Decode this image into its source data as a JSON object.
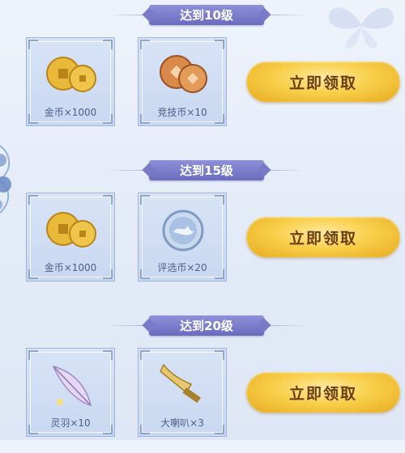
{
  "tiers": [
    {
      "level_label": "达到10级",
      "rewards": [
        {
          "icon": "gold-coins-icon",
          "label": "金币×1000"
        },
        {
          "icon": "arena-coins-icon",
          "label": "竞技币×10"
        }
      ],
      "claim_label": "立即领取"
    },
    {
      "level_label": "达到15级",
      "rewards": [
        {
          "icon": "gold-coins-icon",
          "label": "金币×1000"
        },
        {
          "icon": "selection-coin-icon",
          "label": "评选币×20"
        }
      ],
      "claim_label": "立即领取"
    },
    {
      "level_label": "达到20级",
      "rewards": [
        {
          "icon": "spirit-feather-icon",
          "label": "灵羽×10"
        },
        {
          "icon": "loudspeaker-icon",
          "label": "大喇叭×3"
        }
      ],
      "claim_label": "立即领取"
    }
  ],
  "colors": {
    "banner": "#7a7bc8",
    "button_gold": "#f8cf4a",
    "button_text": "#6a3e12",
    "card_bg": "#d3dff4"
  }
}
